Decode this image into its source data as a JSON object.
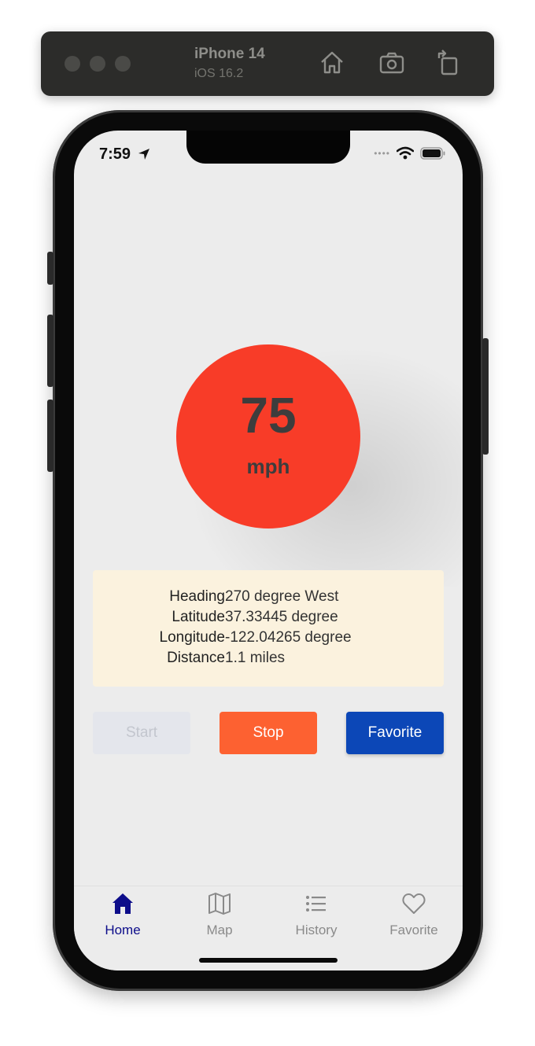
{
  "simulator": {
    "device": "iPhone 14",
    "os": "iOS 16.2"
  },
  "status_bar": {
    "time": "7:59",
    "signal": "••••"
  },
  "speedometer": {
    "value": "75",
    "unit": "mph",
    "color": "#f83c28"
  },
  "info": {
    "rows": [
      {
        "label": "Heading",
        "value": "270 degree West"
      },
      {
        "label": "Latitude",
        "value": "37.33445 degree"
      },
      {
        "label": "Longitude",
        "value": "-122.04265 degree"
      },
      {
        "label": "Distance",
        "value": "1.1 miles"
      }
    ]
  },
  "buttons": {
    "start": "Start",
    "stop": "Stop",
    "favorite": "Favorite"
  },
  "tabs": [
    {
      "label": "Home",
      "icon": "home-icon",
      "active": true
    },
    {
      "label": "Map",
      "icon": "map-icon",
      "active": false
    },
    {
      "label": "History",
      "icon": "list-icon",
      "active": false
    },
    {
      "label": "Favorite",
      "icon": "heart-icon",
      "active": false
    }
  ],
  "colors": {
    "stop": "#fd6131",
    "favorite": "#0c47b7",
    "active_tab": "#0d0d8a",
    "card_bg": "#fbf2de"
  }
}
